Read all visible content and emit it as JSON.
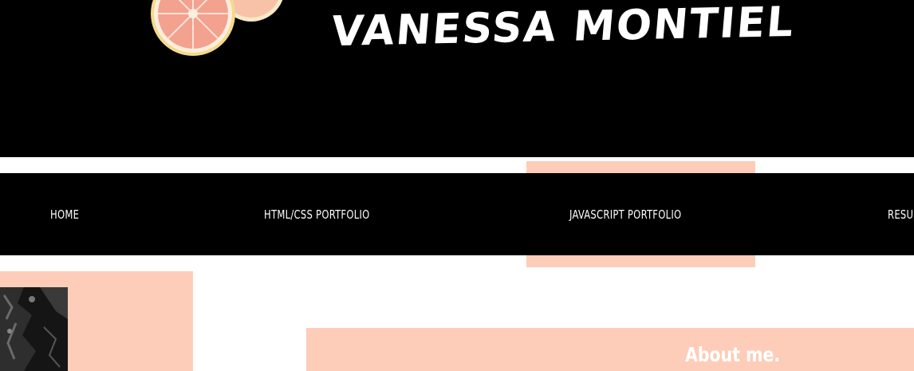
{
  "header": {
    "title": "VANESSA MONTIEL",
    "logo_icon": "grapefruit-slices-icon",
    "background_color": "#000000"
  },
  "nav": {
    "items": [
      {
        "label": "HOME",
        "active": false
      },
      {
        "label": "HTML/CSS PORTFOLIO",
        "active": false
      },
      {
        "label": "JAVASCRIPT PORTFOLIO",
        "active": true
      },
      {
        "label": "RESU",
        "active": false
      }
    ],
    "active_color": "#fdcdb9",
    "text_color": "#ffffff"
  },
  "main": {
    "about_heading": "About me.",
    "accent_color": "#fdcdb9"
  }
}
